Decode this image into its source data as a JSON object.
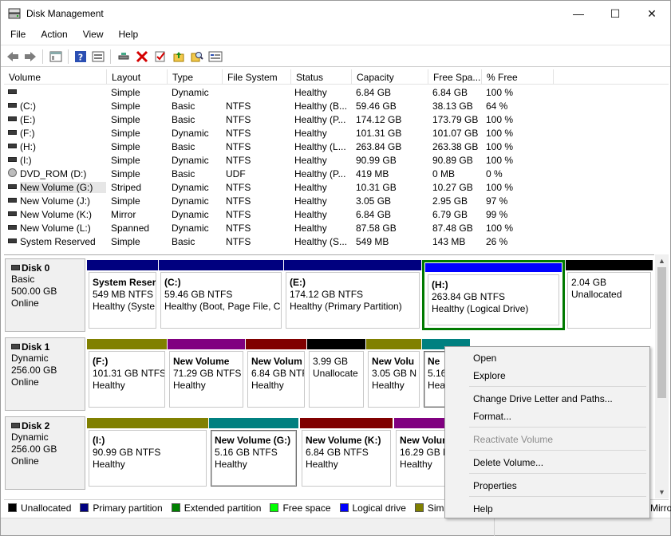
{
  "window": {
    "title": "Disk Management",
    "minimize": "—",
    "maximize": "☐",
    "close": "✕"
  },
  "menu": [
    "File",
    "Action",
    "View",
    "Help"
  ],
  "toolbar": {
    "icons": [
      "back-icon",
      "forward-icon",
      "properties-pane-icon",
      "help-icon",
      "console-icon",
      "connect-icon",
      "delete-icon",
      "check-icon",
      "folder-up-icon",
      "search-icon",
      "settings-icon"
    ]
  },
  "columns": [
    "Volume",
    "Layout",
    "Type",
    "File System",
    "Status",
    "Capacity",
    "Free Spa...",
    "% Free"
  ],
  "volumes": [
    {
      "volume": "",
      "layout": "Simple",
      "type": "Dynamic",
      "fs": "",
      "status": "Healthy",
      "capacity": "6.84 GB",
      "free": "6.84 GB",
      "pct": "100 %"
    },
    {
      "volume": "(C:)",
      "layout": "Simple",
      "type": "Basic",
      "fs": "NTFS",
      "status": "Healthy (B...",
      "capacity": "59.46 GB",
      "free": "38.13 GB",
      "pct": "64 %"
    },
    {
      "volume": "(E:)",
      "layout": "Simple",
      "type": "Basic",
      "fs": "NTFS",
      "status": "Healthy (P...",
      "capacity": "174.12 GB",
      "free": "173.79 GB",
      "pct": "100 %"
    },
    {
      "volume": "(F:)",
      "layout": "Simple",
      "type": "Dynamic",
      "fs": "NTFS",
      "status": "Healthy",
      "capacity": "101.31 GB",
      "free": "101.07 GB",
      "pct": "100 %"
    },
    {
      "volume": "(H:)",
      "layout": "Simple",
      "type": "Basic",
      "fs": "NTFS",
      "status": "Healthy (L...",
      "capacity": "263.84 GB",
      "free": "263.38 GB",
      "pct": "100 %"
    },
    {
      "volume": "(I:)",
      "layout": "Simple",
      "type": "Dynamic",
      "fs": "NTFS",
      "status": "Healthy",
      "capacity": "90.99 GB",
      "free": "90.89 GB",
      "pct": "100 %"
    },
    {
      "volume": "DVD_ROM (D:)",
      "layout": "Simple",
      "type": "Basic",
      "fs": "UDF",
      "status": "Healthy (P...",
      "capacity": "419 MB",
      "free": "0 MB",
      "pct": "0 %"
    },
    {
      "volume": "New Volume (G:)",
      "layout": "Striped",
      "type": "Dynamic",
      "fs": "NTFS",
      "status": "Healthy",
      "capacity": "10.31 GB",
      "free": "10.27 GB",
      "pct": "100 %"
    },
    {
      "volume": "New Volume (J:)",
      "layout": "Simple",
      "type": "Dynamic",
      "fs": "NTFS",
      "status": "Healthy",
      "capacity": "3.05 GB",
      "free": "2.95 GB",
      "pct": "97 %"
    },
    {
      "volume": "New Volume (K:)",
      "layout": "Mirror",
      "type": "Dynamic",
      "fs": "NTFS",
      "status": "Healthy",
      "capacity": "6.84 GB",
      "free": "6.79 GB",
      "pct": "99 %"
    },
    {
      "volume": "New Volume (L:)",
      "layout": "Spanned",
      "type": "Dynamic",
      "fs": "NTFS",
      "status": "Healthy",
      "capacity": "87.58 GB",
      "free": "87.48 GB",
      "pct": "100 %"
    },
    {
      "volume": "System Reserved",
      "layout": "Simple",
      "type": "Basic",
      "fs": "NTFS",
      "status": "Healthy (S...",
      "capacity": "549 MB",
      "free": "143 MB",
      "pct": "26 %"
    }
  ],
  "disks": [
    {
      "name": "Disk 0",
      "type": "Basic",
      "size": "500.00 GB",
      "state": "Online",
      "partitions": [
        {
          "name": "System Reser",
          "size": "549 MB NTFS",
          "status": "Healthy (Syste",
          "color": "#00007f"
        },
        {
          "name": "(C:)",
          "size": "59.46 GB NTFS",
          "status": "Healthy (Boot, Page File, C",
          "color": "#00007f"
        },
        {
          "name": "(E:)",
          "size": "174.12 GB NTFS",
          "status": "Healthy (Primary Partition)",
          "color": "#00007f"
        },
        {
          "name": "(H:)",
          "size": "263.84 GB NTFS",
          "status": "Healthy (Logical Drive)",
          "color": "#0000ff"
        },
        {
          "name": "",
          "size": "2.04 GB",
          "status": "Unallocated",
          "color": "#000000"
        }
      ]
    },
    {
      "name": "Disk 1",
      "type": "Dynamic",
      "size": "256.00 GB",
      "state": "Online",
      "partitions": [
        {
          "name": "(F:)",
          "size": "101.31 GB NTFS",
          "status": "Healthy",
          "color": "#808000"
        },
        {
          "name": "New Volume",
          "size": "71.29 GB NTFS",
          "status": "Healthy",
          "color": "#800080"
        },
        {
          "name": "New Volum",
          "size": "6.84 GB NTF",
          "status": "Healthy",
          "color": "#800000"
        },
        {
          "name": "",
          "size": "3.99 GB",
          "status": "Unallocate",
          "color": "#000000"
        },
        {
          "name": "New Volu",
          "size": "3.05 GB N",
          "status": "Healthy",
          "color": "#808000"
        },
        {
          "name": "Ne",
          "size": "5.16",
          "status": "Hea",
          "color": "#008080"
        }
      ]
    },
    {
      "name": "Disk 2",
      "type": "Dynamic",
      "size": "256.00 GB",
      "state": "Online",
      "partitions": [
        {
          "name": "(I:)",
          "size": "90.99 GB NTFS",
          "status": "Healthy",
          "color": "#808000"
        },
        {
          "name": "New Volume  (G:)",
          "size": "5.16 GB NTFS",
          "status": "Healthy",
          "color": "#008080"
        },
        {
          "name": "New Volume  (K:)",
          "size": "6.84 GB NTFS",
          "status": "Healthy",
          "color": "#800000"
        },
        {
          "name": "New Volum",
          "size": "16.29 GB N",
          "status": "Healthy",
          "color": "#800080"
        }
      ]
    }
  ],
  "legend": [
    {
      "label": "Unallocated",
      "color": "#000000"
    },
    {
      "label": "Primary partition",
      "color": "#00007f"
    },
    {
      "label": "Extended partition",
      "color": "#008000"
    },
    {
      "label": "Free space",
      "color": "#00ff00"
    },
    {
      "label": "Logical drive",
      "color": "#0000ff"
    },
    {
      "label": "Simple vol",
      "color": "#808000"
    }
  ],
  "legend_trailing": "Mirro",
  "context_menu": {
    "open": "Open",
    "explore": "Explore",
    "change_letter": "Change Drive Letter and Paths...",
    "format": "Format...",
    "reactivate": "Reactivate Volume",
    "delete": "Delete Volume...",
    "properties": "Properties",
    "help": "Help"
  }
}
